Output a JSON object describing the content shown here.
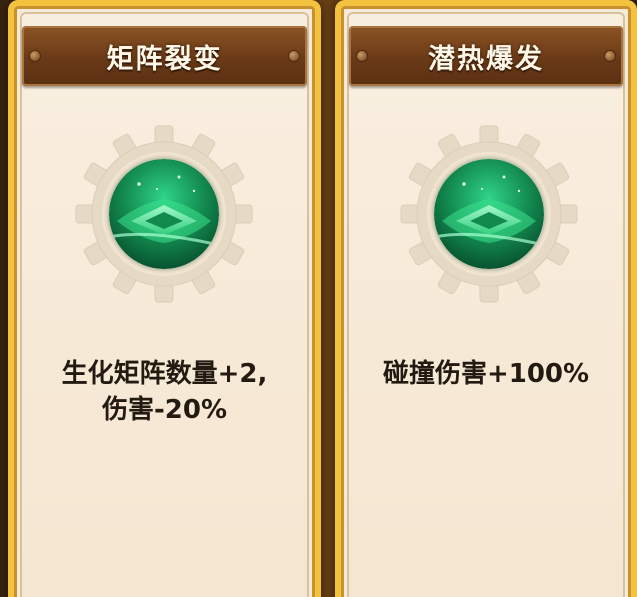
{
  "cards": [
    {
      "title": "矩阵裂变",
      "icon": "green-matrix-orb-icon",
      "description_lines": [
        "生化矩阵数量+2,",
        "伤害-20%"
      ]
    },
    {
      "title": "潜热爆发",
      "icon": "green-matrix-orb-icon",
      "description_lines": [
        "碰撞伤害+100%"
      ]
    }
  ],
  "colors": {
    "card_border": "#f3c23f",
    "title_bar": "#6a3a17",
    "card_background": "#f6ead8",
    "orb_green": "#1fae6a"
  }
}
